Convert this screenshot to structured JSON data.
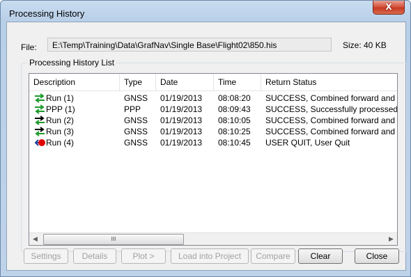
{
  "window": {
    "title": "Processing History",
    "close_glyph": "X"
  },
  "file": {
    "label": "File:",
    "path": "E:\\Temp\\Training\\Data\\GrafNav\\Single Base\\Flight02\\850.his",
    "size": "Size: 40 KB"
  },
  "group": {
    "label": "Processing History List"
  },
  "columns": [
    "Description",
    "Type",
    "Date",
    "Time",
    "Return Status"
  ],
  "rows": [
    {
      "icon": "green-arrows-icon",
      "description": "Run (1)",
      "type": "GNSS",
      "date": "01/19/2013",
      "time": "08:08:20",
      "status": "SUCCESS, Combined forward and reverse"
    },
    {
      "icon": "green-arrows-icon",
      "description": "PPP (1)",
      "type": "PPP",
      "date": "01/19/2013",
      "time": "08:09:43",
      "status": "SUCCESS, Successfully processed"
    },
    {
      "icon": "black-green-arrows-icon",
      "description": "Run (2)",
      "type": "GNSS",
      "date": "01/19/2013",
      "time": "08:10:05",
      "status": "SUCCESS, Combined forward and reverse"
    },
    {
      "icon": "black-green-arrows-icon",
      "description": "Run (3)",
      "type": "GNSS",
      "date": "01/19/2013",
      "time": "08:10:25",
      "status": "SUCCESS, Combined forward and reverse"
    },
    {
      "icon": "quit-arrow-red-dot-icon",
      "description": "Run (4)",
      "type": "GNSS",
      "date": "01/19/2013",
      "time": "08:10:45",
      "status": "USER QUIT, User Quit"
    }
  ],
  "scrollbar": {
    "left": "◀",
    "right": "▶",
    "grip": "III"
  },
  "buttons": {
    "settings": "Settings",
    "details": "Details",
    "plot": "Plot  >",
    "load": "Load into Project",
    "compare": "Compare",
    "clear": "Clear",
    "close": "Close"
  },
  "colors": {
    "arrow_green": "#1a9a2a",
    "arrow_black": "#000000",
    "quit_red": "#e00000",
    "arrow_blue": "#1c3f9a"
  }
}
